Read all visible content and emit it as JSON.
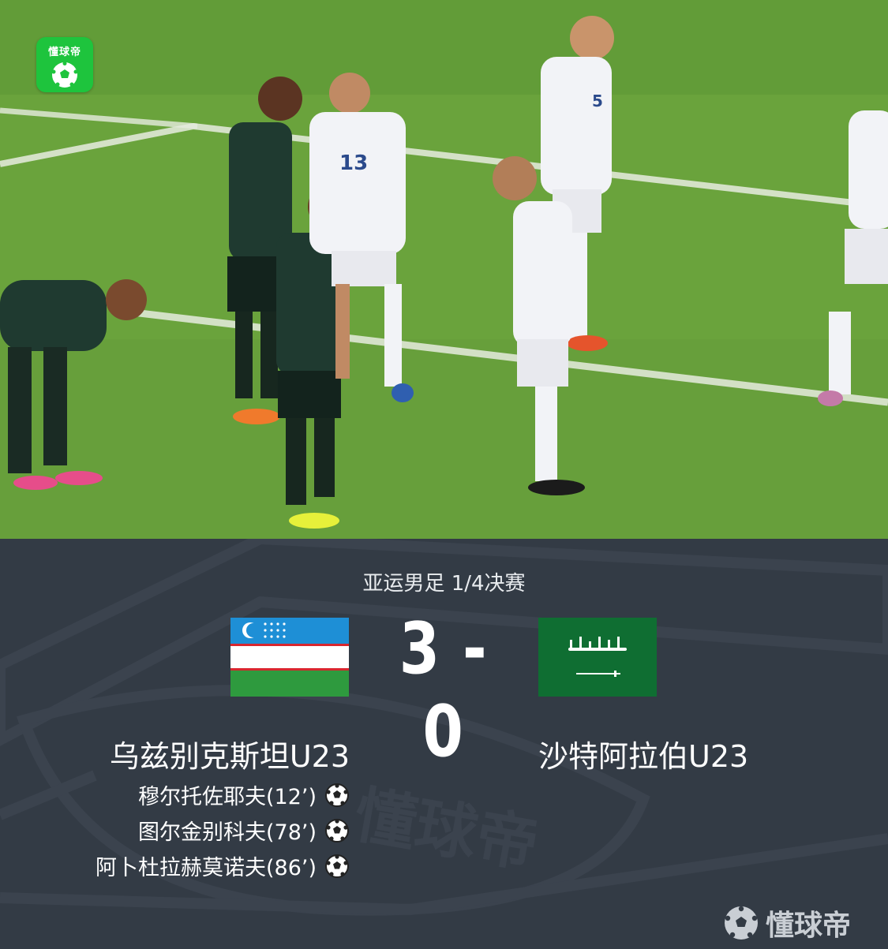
{
  "app": {
    "logo_text": "懂球帝",
    "logo_icon": "soccer-ball-icon",
    "brand_color": "#1ec43d"
  },
  "match": {
    "stage": "亚运男足 1/4决赛",
    "score": "3 - 0",
    "home": {
      "name": "乌兹别克斯坦U23",
      "flag": "uzbekistan-flag-icon",
      "scorers": [
        {
          "text": "穆尔托佐耶夫(12’)"
        },
        {
          "text": "图尔金别科夫(78’)"
        },
        {
          "text": "阿卜杜拉赫莫诺夫(86’)"
        }
      ]
    },
    "away": {
      "name": "沙特阿拉伯U23",
      "flag": "saudi-arabia-flag-icon",
      "scorers": []
    }
  },
  "watermark": {
    "text": "懂球帝",
    "icon": "soccer-ball-icon"
  },
  "colors": {
    "panel_bg": "#333b45",
    "pitch_green": "#6ea63e",
    "text": "#ffffff"
  }
}
